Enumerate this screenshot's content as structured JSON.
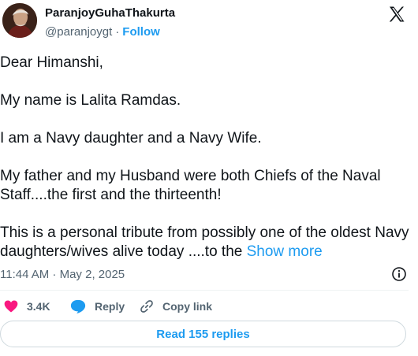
{
  "author": {
    "name": "ParanjoyGuhaThakurta",
    "handle": "@paranjoygt",
    "separator": "·",
    "follow_label": "Follow"
  },
  "post": {
    "paragraphs": [
      "Dear Himanshi,",
      "My name is Lalita Ramdas.",
      "I am a Navy daughter and a Navy Wife.",
      "My father and my Husband were both Chiefs of the Naval Staff....the first and the thirteenth!"
    ],
    "last_paragraph": "This is a personal tribute from possibly one of the oldest Navy daughters/wives alive today ....to the ",
    "show_more_label": "Show more",
    "timestamp": "11:44 AM · May 2, 2025"
  },
  "actions": {
    "likes_count": "3.4K",
    "reply_label": "Reply",
    "copy_link_label": "Copy link"
  },
  "read_replies_label": "Read 155 replies",
  "colors": {
    "accent": "#1d9bf0",
    "like": "#f91880",
    "secondary_text": "#536471",
    "border": "#cfd9de"
  },
  "icons": {
    "logo": "x-logo-icon",
    "info": "info-icon",
    "like": "heart-icon",
    "reply": "speech-bubble-icon",
    "copy": "link-icon"
  }
}
